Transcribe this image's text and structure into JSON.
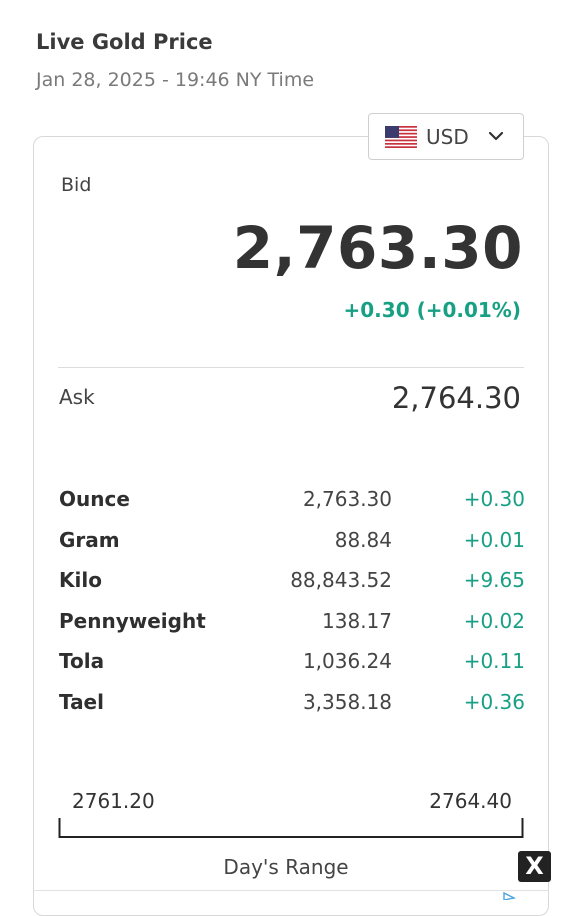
{
  "header": {
    "title": "Live Gold Price",
    "subtitle": "Jan 28, 2025 - 19:46 NY Time"
  },
  "currency_selector": {
    "selected": "USD",
    "flag_icon": "us-flag-icon"
  },
  "bid": {
    "label": "Bid",
    "value": "2,763.30",
    "change": "+0.30 (+0.01%)"
  },
  "ask": {
    "label": "Ask",
    "value": "2,764.30"
  },
  "units": [
    {
      "name": "Ounce",
      "price": "2,763.30",
      "change": "+0.30"
    },
    {
      "name": "Gram",
      "price": "88.84",
      "change": "+0.01"
    },
    {
      "name": "Kilo",
      "price": "88,843.52",
      "change": "+9.65"
    },
    {
      "name": "Pennyweight",
      "price": "138.17",
      "change": "+0.02"
    },
    {
      "name": "Tola",
      "price": "1,036.24",
      "change": "+0.11"
    },
    {
      "name": "Tael",
      "price": "3,358.18",
      "change": "+0.36"
    }
  ],
  "days_range": {
    "low": "2761.20",
    "high": "2764.40",
    "caption": "Day's Range"
  },
  "ad": {
    "close_label": "X"
  },
  "colors": {
    "positive": "#18a085",
    "text": "#333333",
    "border": "#d8d8d8"
  }
}
